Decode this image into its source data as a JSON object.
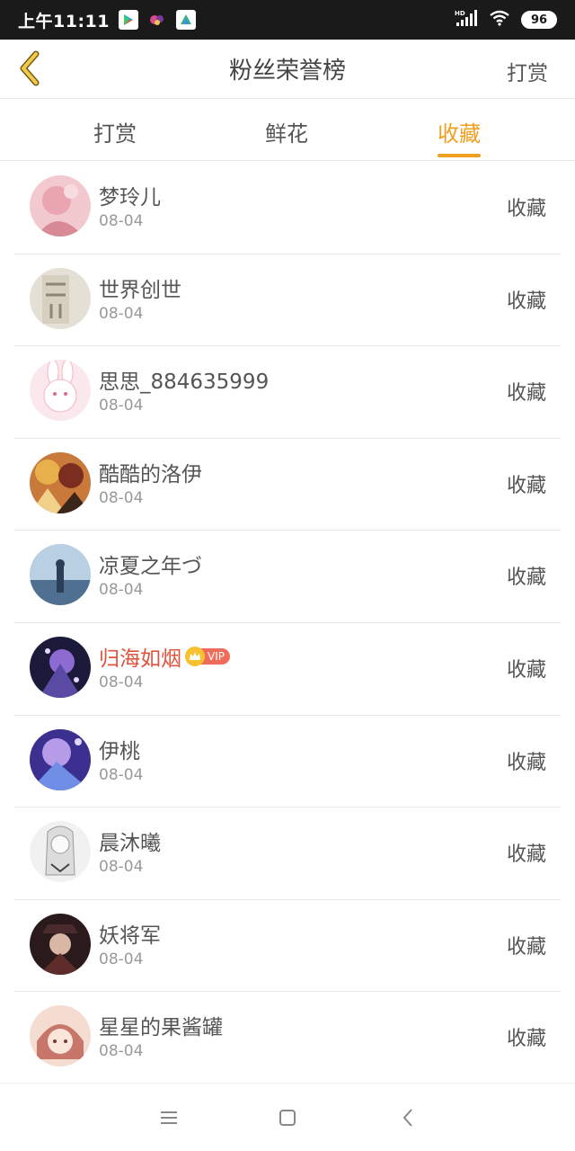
{
  "status_bar": {
    "time": "上午11:11",
    "network": "HD",
    "battery": "96",
    "notification_icons": [
      "play-store-icon",
      "game-icon",
      "app-icon"
    ]
  },
  "nav": {
    "title": "粉丝荣誉榜",
    "action": "打赏"
  },
  "tabs": [
    {
      "label": "打赏",
      "active": false
    },
    {
      "label": "鲜花",
      "active": false
    },
    {
      "label": "收藏",
      "active": true
    }
  ],
  "colors": {
    "accent": "#f0a020",
    "vip_name": "#e0533c",
    "vip_badge": "#f06c5a"
  },
  "vip_label": "VIP",
  "list": [
    {
      "name": "梦玲儿",
      "date": "08-04",
      "action": "收藏",
      "vip": false
    },
    {
      "name": "世界创世",
      "date": "08-04",
      "action": "收藏",
      "vip": false
    },
    {
      "name": "思思_884635999",
      "date": "08-04",
      "action": "收藏",
      "vip": false
    },
    {
      "name": "酷酷的洛伊",
      "date": "08-04",
      "action": "收藏",
      "vip": false
    },
    {
      "name": "凉夏之年づ",
      "date": "08-04",
      "action": "收藏",
      "vip": false
    },
    {
      "name": "归海如烟",
      "date": "08-04",
      "action": "收藏",
      "vip": true
    },
    {
      "name": "伊桃",
      "date": "08-04",
      "action": "收藏",
      "vip": false
    },
    {
      "name": "晨沐曦",
      "date": "08-04",
      "action": "收藏",
      "vip": false
    },
    {
      "name": "妖将军",
      "date": "08-04",
      "action": "收藏",
      "vip": false
    },
    {
      "name": "星星的果酱罐",
      "date": "08-04",
      "action": "收藏",
      "vip": false
    }
  ],
  "system_nav": [
    "menu-icon",
    "home-icon",
    "back-icon"
  ]
}
